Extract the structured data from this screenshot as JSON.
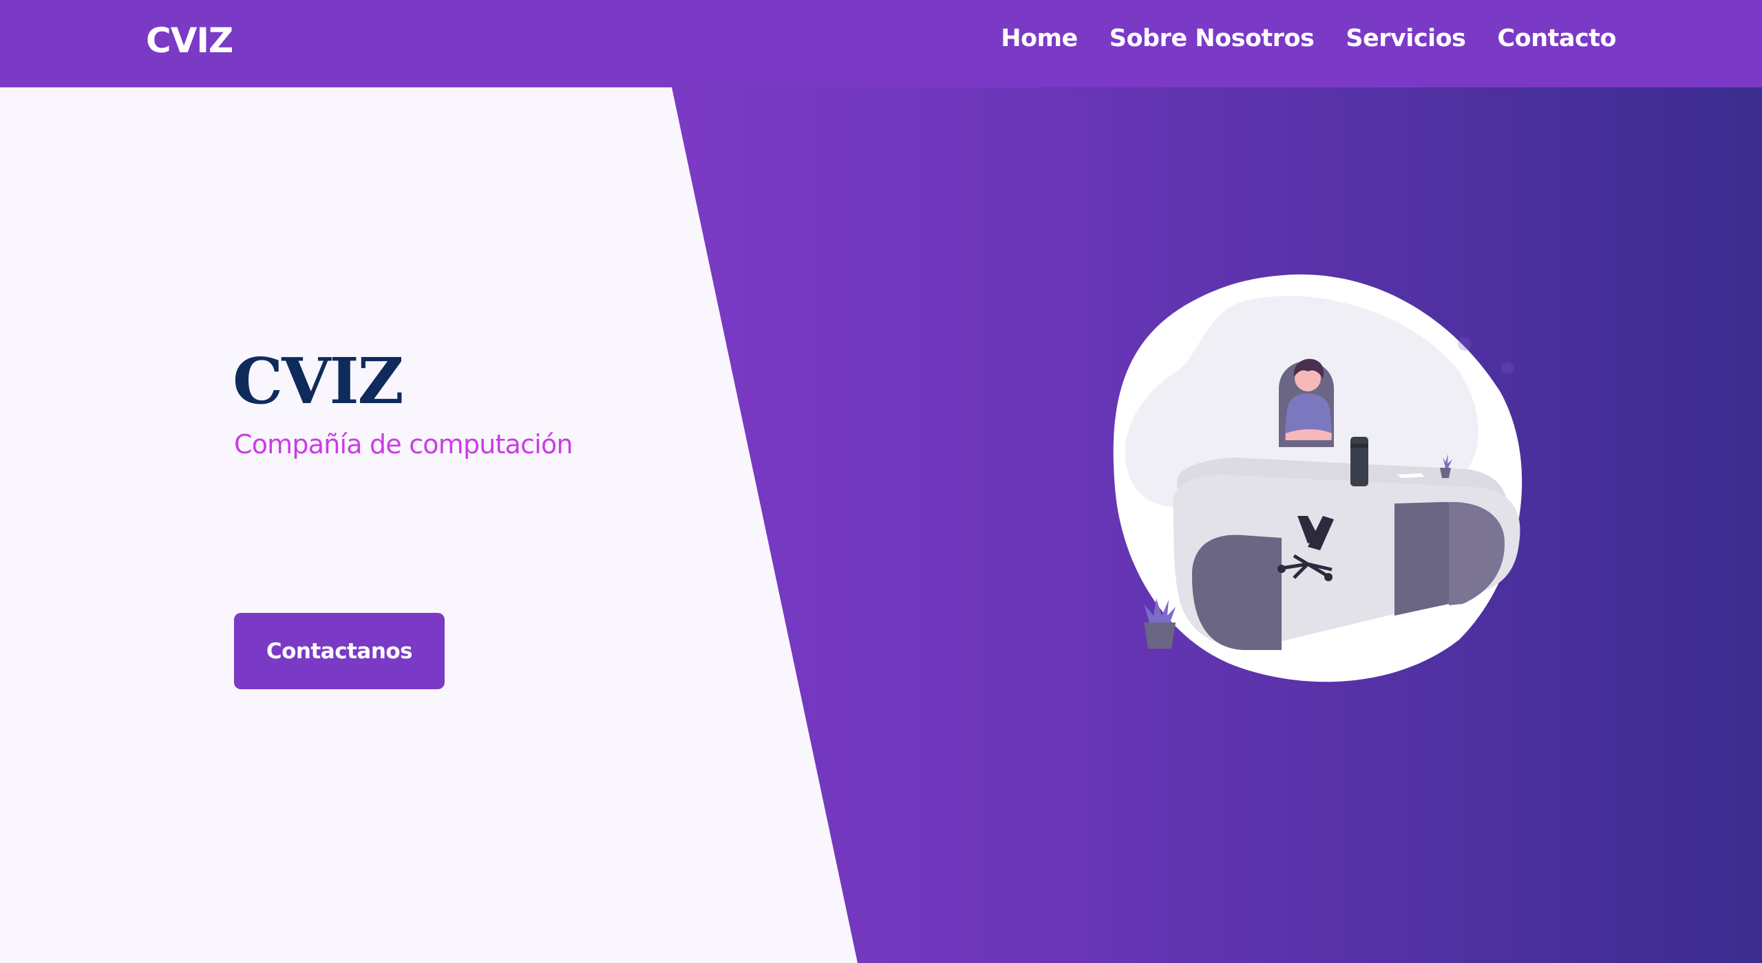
{
  "header": {
    "logo": "CVIZ",
    "nav": [
      {
        "label": "Home"
      },
      {
        "label": "Sobre Nosotros"
      },
      {
        "label": "Servicios"
      },
      {
        "label": "Contacto"
      }
    ]
  },
  "hero": {
    "title": "CVIZ",
    "subtitle": "Compañía de computación",
    "cta_label": "Contactanos",
    "illustration": "person-at-desk-illustration"
  },
  "colors": {
    "brand_purple": "#7b3ac5",
    "gradient_end": "#3b2d8f",
    "title_navy": "#0f2b5c",
    "subtitle_magenta": "#c93de3",
    "light_bg": "#faf6fd"
  }
}
